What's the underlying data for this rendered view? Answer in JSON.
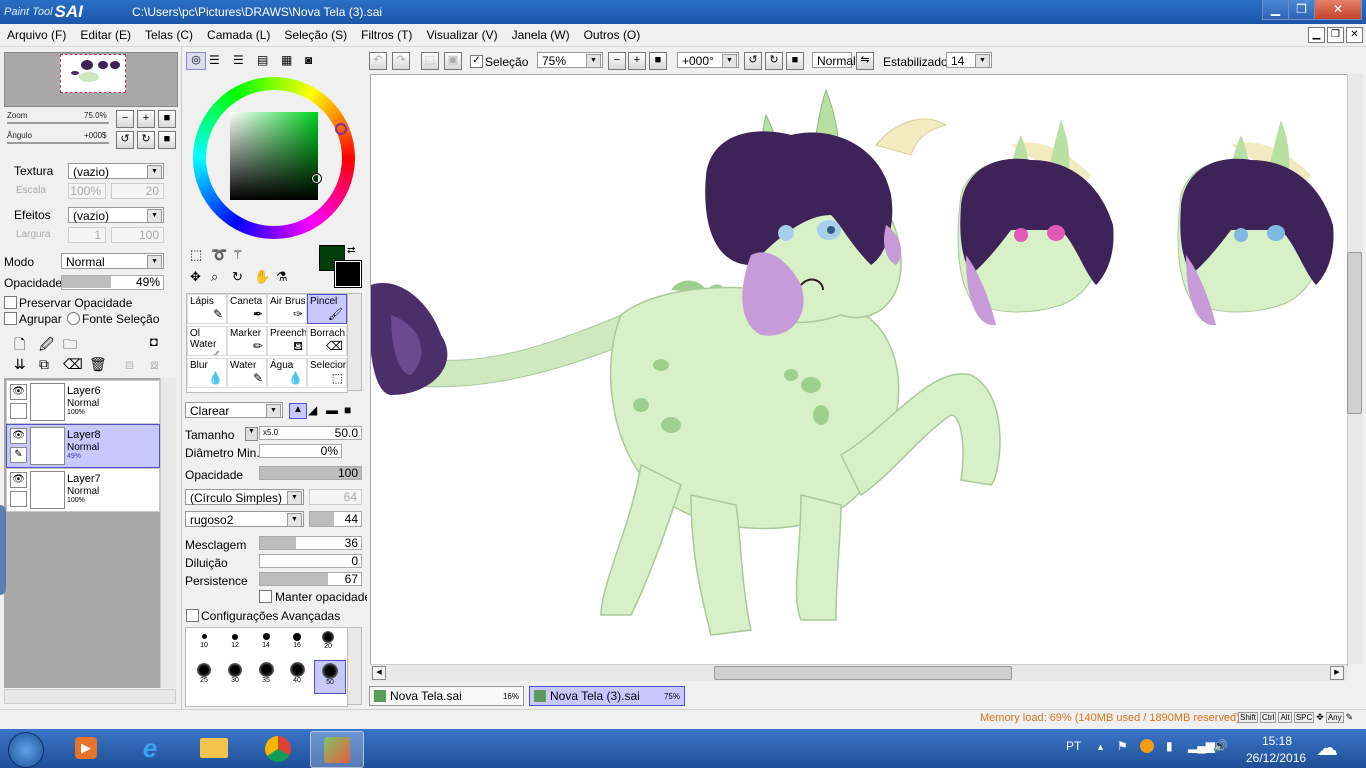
{
  "window": {
    "logo_small": "Paint Tool",
    "logo_big": "SAI",
    "title": "C:\\Users\\pc\\Pictures\\DRAWS\\Nova Tela (3).sai"
  },
  "menubar": [
    "Arquivo (F)",
    "Editar (E)",
    "Telas (C)",
    "Camada (L)",
    "Seleção (S)",
    "Filtros (T)",
    "Visualizar (V)",
    "Janela (W)",
    "Outros (O)"
  ],
  "navigator": {
    "zoom_label": "Zoom",
    "zoom_value": "75.0%",
    "angle_label": "Ângulo",
    "angle_value": "+000$"
  },
  "paper": {
    "texture_label": "Textura",
    "texture_value": "(vazio)",
    "scale_label": "Escala",
    "scale_value": "100%",
    "scale_value2": "20",
    "effects_label": "Efeitos",
    "effects_value": "(vazio)",
    "width_label": "Largura",
    "width_value": "1",
    "width_value2": "100"
  },
  "layer_props": {
    "mode_label": "Modo",
    "mode_value": "Normal",
    "opacity_label": "Opacidade",
    "opacity_value": "49%",
    "opacity_fraction": 0.49,
    "preserve_label": "Preservar Opacidade",
    "group_label": "Agrupar",
    "source_label": "Fonte Seleção"
  },
  "layers": [
    {
      "name": "Layer6",
      "mode": "Normal",
      "opacity": "100%",
      "selected": false
    },
    {
      "name": "Layer8",
      "mode": "Normal",
      "opacity": "49%",
      "selected": true
    },
    {
      "name": "Layer7",
      "mode": "Normal",
      "opacity": "100%",
      "selected": false
    }
  ],
  "brushes": [
    [
      "Lápis",
      "Caneta",
      "Air Brus",
      "Pincel"
    ],
    [
      "Ol Water",
      "Marker",
      "Preench",
      "Borrach"
    ],
    [
      "Blur",
      "Water",
      "Água",
      "Selecior"
    ]
  ],
  "brush_settings": {
    "blend_mode": "Clarear",
    "size_label": "Tamanho",
    "size_mult": "x5.0",
    "size_value": "50.0",
    "min_diam_label": "Diâmetro Min.",
    "min_diam_value": "0%",
    "min_diam_fraction": 0,
    "opacity_label": "Opacidade",
    "opacity_value": "100",
    "opacity_fraction": 1.0,
    "shape_value": "(Círculo Simples)",
    "shape_num": "64",
    "texture_value": "rugoso2",
    "texture_num": "44",
    "blend_label": "Mesclagem",
    "blend_value": "36",
    "blend_fraction": 0.36,
    "dilution_label": "Diluição",
    "dilution_value": "0",
    "dilution_fraction": 0,
    "persistence_label": "Persistence",
    "persistence_value": "67",
    "persistence_fraction": 0.67,
    "keep_opacity_label": "Manter opacidade",
    "advanced_label": "Configurações Avançadas",
    "dot_sizes_row1": [
      "10",
      "12",
      "14",
      "16",
      "20"
    ],
    "dot_sizes_row2": [
      "25",
      "30",
      "35",
      "40",
      "50"
    ],
    "selected_dot": "50"
  },
  "canvas_toolbar": {
    "selection_label": "Seleção",
    "zoom_value": "75%",
    "angle_value": "+000°",
    "blend_value": "Normal",
    "stabilizer_label": "Estabilizador",
    "stabilizer_value": "14"
  },
  "colors": {
    "primary": "#003d0a",
    "secondary": "#000000",
    "selection": "#c8c8ff",
    "titlebar": "#2b6fc7"
  },
  "tabs": [
    {
      "name": "Nova Tela.sai",
      "zoom": "16%",
      "active": false
    },
    {
      "name": "Nova Tela (3).sai",
      "zoom": "75%",
      "active": true
    }
  ],
  "status": {
    "memory": "Memory load: 69% (140MB used / 1890MB reserved)",
    "keys": [
      "Shift",
      "Ctrl",
      "Alt",
      "SPC",
      "Any"
    ]
  },
  "taskbar": {
    "lang": "PT",
    "time": "15:18",
    "date": "26/12/2016",
    "apps": [
      "windows-start",
      "media-player",
      "internet-explorer",
      "file-explorer",
      "chrome",
      "paint-tool-sai"
    ]
  }
}
